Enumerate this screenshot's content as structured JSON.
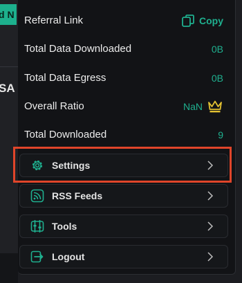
{
  "background": {
    "badge_text": "d N",
    "side_text": "SA"
  },
  "menu": {
    "rows": [
      {
        "label": "Referral Link",
        "value": "Copy",
        "icon": "copy-icon"
      },
      {
        "label": "Total Data Downloaded",
        "value": "0B"
      },
      {
        "label": "Total Data Egress",
        "value": "0B"
      },
      {
        "label": "Overall Ratio",
        "value": "NaN",
        "icon": "crown-icon"
      },
      {
        "label": "Total Downloaded",
        "value": "9"
      }
    ],
    "items": [
      {
        "label": "Settings",
        "icon": "gear-icon"
      },
      {
        "label": "RSS Feeds",
        "icon": "rss-icon"
      },
      {
        "label": "Tools",
        "icon": "tools-icon"
      },
      {
        "label": "Logout",
        "icon": "logout-icon"
      }
    ]
  },
  "colors": {
    "accent": "#1fb08f",
    "crown": "#e2c132",
    "highlight": "#e0452a",
    "panel": "#121316"
  }
}
